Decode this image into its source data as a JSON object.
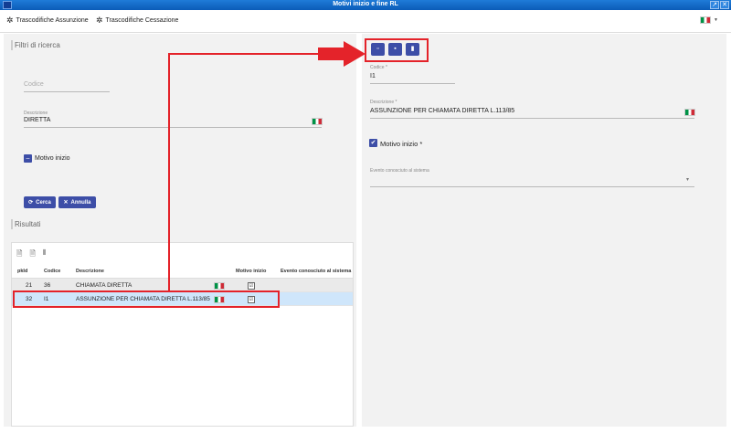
{
  "window": {
    "title": "Motivi inizio e fine RL",
    "restore_icon": "↗",
    "close_icon": "✕"
  },
  "tabs": [
    {
      "label": "Trascodifiche Assunzione",
      "icon": "gear-icon"
    },
    {
      "label": "Trascodifiche Cessazione",
      "icon": "gear-icon"
    }
  ],
  "language": {
    "flag": "italian-flag-icon",
    "caret": "▼"
  },
  "filters": {
    "section_title": "Filtri di ricerca",
    "codice_placeholder": "Codice",
    "descrizione_label": "Descrizione",
    "descrizione_value": "DIRETTA",
    "motivo_inizio_label": "Motivo inizio",
    "motivo_inizio_icon": "–",
    "search_button": "Cerca",
    "search_icon": "⟳",
    "cancel_button": "Annulla",
    "cancel_icon": "✕"
  },
  "results": {
    "section_title": "Risultati",
    "toolbar_icons": [
      "🗎",
      "🗎",
      "⦀"
    ],
    "columns": [
      "pkId",
      "Codice",
      "Descrizione",
      "Motivo inizio",
      "Evento conosciuto al sistema"
    ],
    "rows": [
      {
        "pkid": "21",
        "codice": "36",
        "descrizione": "CHIAMATA DIRETTA",
        "motivo_inizio": "☑"
      },
      {
        "pkid": "32",
        "codice": "I1",
        "descrizione": "ASSUNZIONE PER CHIAMATA DIRETTA L.113/85",
        "motivo_inizio": "☑"
      }
    ]
  },
  "detail": {
    "action_icons": [
      "▫",
      "▪",
      "▮"
    ],
    "codice_label": "Codice *",
    "codice_value": "I1",
    "descrizione_label": "Descrizione *",
    "descrizione_value": "ASSUNZIONE PER CHIAMATA DIRETTA L.113/85",
    "motivo_inizio_label": "Motivo inizio *",
    "motivo_inizio_icon": "✔",
    "evento_label": "Evento conosciuto al sistema",
    "evento_caret": "▾"
  },
  "colors": {
    "accent": "#3d4ea7",
    "titlebar": "#1565c0",
    "highlight": "#e4232a",
    "selected_row": "#cfe6fb"
  }
}
